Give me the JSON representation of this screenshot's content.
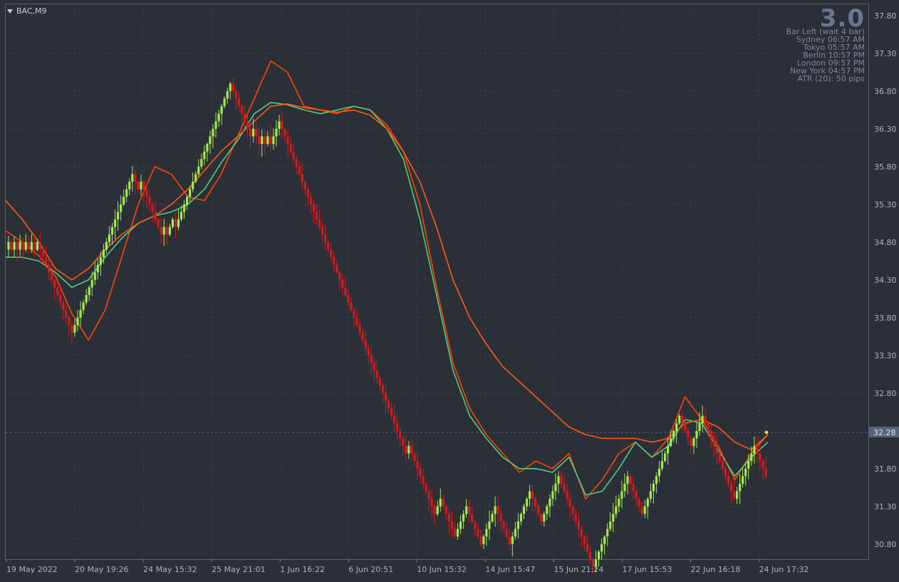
{
  "symbol": "BAC,M9",
  "big_number": "3.0",
  "info_panel": [
    "Bar Left (wait 4 bar)",
    "Sydney 06:57 AM",
    "Tokyo 05:57 AM",
    "Berlin 10:57 PM",
    "London 09:57 PM",
    "New York 04:57 PM",
    "ATR (20): 50 pips"
  ],
  "colors": {
    "background": "#2b2f38",
    "grid": "#3e4552",
    "bull_bar": "#a4ea4e",
    "bear_bar": "#d81a1a",
    "fast_ma": "#ff4500",
    "medium_ma": "#4fcf82",
    "slow_ma": "#ff5a14",
    "axis_text": "#aeb4bf",
    "price_tag_bg": "#566277"
  },
  "chart_data": {
    "type": "renko-candlestick",
    "symbol": "BAC",
    "timeframe": "M9",
    "ylim": [
      30.6,
      37.95
    ],
    "y_ticks": [
      "37.80",
      "37.30",
      "36.80",
      "36.30",
      "35.80",
      "35.30",
      "34.80",
      "34.30",
      "33.80",
      "33.30",
      "32.80",
      "32.28",
      "31.80",
      "31.30",
      "30.80"
    ],
    "current_price": "32.28",
    "x_ticks": [
      "19 May 2022",
      "20 May 19:26",
      "24 May 15:32",
      "25 May 21:01",
      "1 Jun 16:22",
      "6 Jun 20:51",
      "10 Jun 15:32",
      "14 Jun 15:47",
      "15 Jun 21:24",
      "17 Jun 15:53",
      "22 Jun 16:18",
      "24 Jun 17:32"
    ],
    "brick_size": 0.1,
    "bricks_direction": "+1 up / -1 down; closes start from the first value",
    "first_close": 34.7,
    "moves": [
      1,
      -1,
      1,
      -1,
      1,
      -1,
      1,
      -1,
      1,
      -1,
      1,
      -1,
      -1,
      -1,
      -1,
      -1,
      -1,
      -1,
      -1,
      -1,
      -1,
      -1,
      -1,
      1,
      1,
      1,
      1,
      1,
      1,
      1,
      1,
      1,
      1,
      1,
      1,
      1,
      1,
      1,
      1,
      1,
      1,
      1,
      1,
      1,
      -1,
      -1,
      1,
      -1,
      -1,
      -1,
      -1,
      -1,
      -1,
      -1,
      1,
      -1,
      1,
      1,
      -1,
      1,
      1,
      1,
      1,
      1,
      1,
      1,
      1,
      1,
      1,
      1,
      1,
      1,
      1,
      1,
      1,
      1,
      1,
      1,
      -1,
      -1,
      -1,
      -1,
      -1,
      -1,
      -1,
      1,
      -1,
      -1,
      1,
      -1,
      1,
      -1,
      1,
      1,
      1,
      -1,
      -1,
      -1,
      -1,
      -1,
      -1,
      -1,
      -1,
      -1,
      -1,
      -1,
      -1,
      -1,
      -1,
      -1,
      -1,
      -1,
      -1,
      -1,
      -1,
      -1,
      -1,
      -1,
      -1,
      -1,
      -1,
      -1,
      -1,
      -1,
      -1,
      -1,
      -1,
      -1,
      -1,
      -1,
      -1,
      -1,
      -1,
      -1,
      -1,
      -1,
      -1,
      -1,
      -1,
      1,
      -1,
      -1,
      -1,
      -1,
      -1,
      -1,
      -1,
      -1,
      -1,
      1,
      1,
      -1,
      -1,
      -1,
      -1,
      -1,
      1,
      1,
      1,
      1,
      -1,
      -1,
      -1,
      -1,
      -1,
      1,
      1,
      1,
      1,
      1,
      -1,
      -1,
      -1,
      -1,
      -1,
      1,
      1,
      1,
      1,
      1,
      1,
      1,
      -1,
      -1,
      -1,
      -1,
      1,
      1,
      1,
      1,
      1,
      1,
      -1,
      -1,
      -1,
      -1,
      -1,
      -1,
      -1,
      -1,
      -1,
      -1,
      -1,
      -1,
      1,
      1,
      1,
      1,
      1,
      1,
      1,
      1,
      1,
      1,
      1,
      1,
      -1,
      -1,
      -1,
      -1,
      -1,
      1,
      1,
      1,
      1,
      1,
      1,
      1,
      1,
      1,
      1,
      1,
      1,
      1,
      -1,
      -1,
      -1,
      -1,
      1,
      1,
      1,
      1,
      -1,
      -1,
      -1,
      -1,
      -1,
      -1,
      -1,
      -1,
      -1,
      -1,
      -1,
      1,
      1,
      1,
      1,
      1,
      1,
      1,
      -1,
      -1,
      -1,
      -1
    ],
    "series": [
      {
        "name": "fast",
        "values": [
          34.95,
          34.8,
          34.62,
          34.35,
          33.85,
          33.5,
          33.9,
          34.6,
          35.3,
          35.8,
          35.7,
          35.4,
          35.35,
          35.7,
          36.2,
          36.7,
          37.2,
          37.05,
          36.6,
          36.55,
          36.5,
          36.6,
          36.55,
          36.35,
          36.0,
          35.3,
          34.2,
          33.2,
          32.6,
          32.25,
          32.0,
          31.75,
          31.9,
          31.8,
          32.0,
          31.4,
          31.65,
          32.0,
          32.15,
          31.95,
          32.2,
          32.75,
          32.45,
          32.1,
          31.65,
          32.0,
          32.25
        ]
      },
      {
        "name": "medium",
        "values": [
          34.6,
          34.6,
          34.55,
          34.4,
          34.2,
          34.3,
          34.6,
          34.85,
          35.05,
          35.15,
          35.2,
          35.3,
          35.5,
          35.85,
          36.15,
          36.5,
          36.65,
          36.62,
          36.55,
          36.5,
          36.55,
          36.6,
          36.55,
          36.3,
          35.9,
          35.1,
          34.1,
          33.1,
          32.5,
          32.2,
          31.95,
          31.8,
          31.8,
          31.75,
          31.95,
          31.45,
          31.5,
          31.8,
          32.15,
          31.95,
          32.1,
          32.45,
          32.4,
          32.05,
          31.7,
          31.95,
          32.15
        ]
      },
      {
        "name": "slow",
        "values": [
          35.35,
          35.1,
          34.8,
          34.45,
          34.3,
          34.45,
          34.7,
          34.9,
          35.05,
          35.15,
          35.3,
          35.5,
          35.75,
          36.0,
          36.2,
          36.4,
          36.6,
          36.63,
          36.58,
          36.55,
          36.52,
          36.55,
          36.48,
          36.3,
          36.0,
          35.6,
          35.0,
          34.3,
          33.8,
          33.45,
          33.15,
          32.95,
          32.75,
          32.55,
          32.35,
          32.25,
          32.2,
          32.2,
          32.2,
          32.15,
          32.2,
          32.4,
          32.45,
          32.35,
          32.15,
          32.05,
          32.25
        ]
      }
    ]
  }
}
